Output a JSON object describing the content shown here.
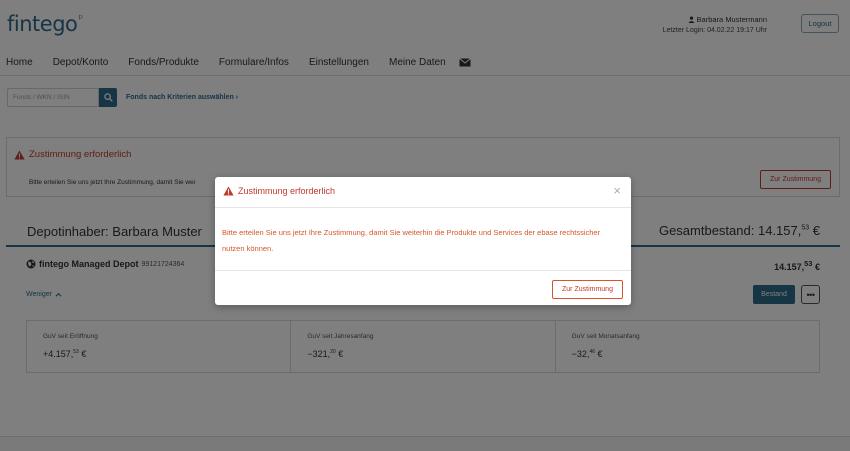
{
  "header": {
    "logo": "fintego",
    "user_name": "Barbara Mustermann",
    "last_login": "Letzter Login: 04.02.22 19:17 Uhr",
    "logout_label": "Logout"
  },
  "nav": {
    "items": [
      "Home",
      "Depot/Konto",
      "Fonds/Produkte",
      "Formulare/Infos",
      "Einstellungen",
      "Meine Daten"
    ]
  },
  "search": {
    "placeholder": "Fonds / WKN / ISIN",
    "criteria_link": "Fonds nach Kriterien auswählen ›"
  },
  "alert": {
    "title": "Zustimmung erforderlich",
    "text": "Bitte erteilen Sie uns jetzt Ihre Zustimmung, damit Sie wei",
    "button_label": "Zur Zustimmung"
  },
  "depot": {
    "owner": "Depotinhaber: Barbara Muster",
    "gesamt_label": "Gesamtbestand:",
    "gesamt_main": "14.157,",
    "gesamt_cents": "53",
    "gesamt_currency": "€",
    "managed_name": "fintego Managed Depot",
    "managed_account": "99121724364",
    "managed_main": "14.157,",
    "managed_cents": "53",
    "managed_currency": "€",
    "weniger_label": "Weniger",
    "bestand_label": "Bestand",
    "more_label": "•••",
    "guv": [
      {
        "label": "GuV seit Eröffnung",
        "main": "+4.157,",
        "cents": "53",
        "currency": "€"
      },
      {
        "label": "GuV seit Jahresanfang",
        "main": "−321,",
        "cents": "20",
        "currency": "€"
      },
      {
        "label": "GuV seit Monatsanfang",
        "main": "−32,",
        "cents": "46",
        "currency": "€"
      }
    ]
  },
  "modal": {
    "title": "Zustimmung erforderlich",
    "close": "×",
    "body": "Bitte erteilen Sie uns jetzt Ihre Zustimmung, damit Sie weiterhin die Produkte und Services der ebase rechtssicher nutzen können.",
    "button_label": "Zur Zustimmung"
  },
  "colors": {
    "brand": "#2d6a8a",
    "warning": "#c0392b",
    "modal_text": "#d4562a"
  }
}
